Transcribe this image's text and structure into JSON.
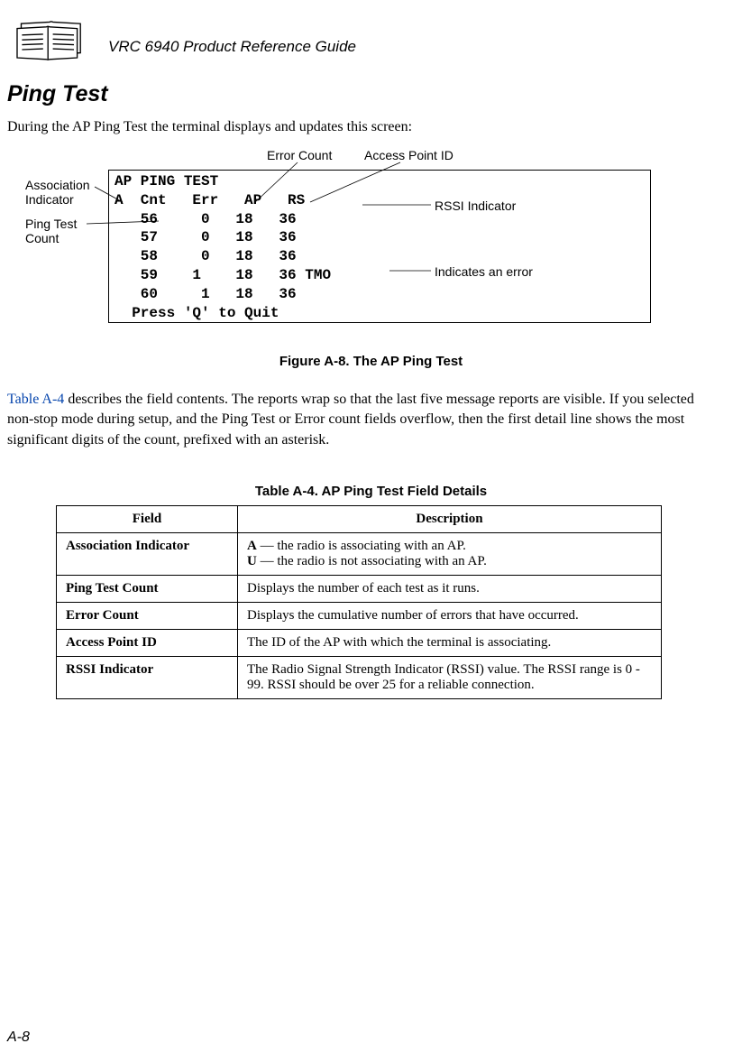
{
  "header": {
    "product": "VRC 6940 Product Reference Guide"
  },
  "section": {
    "title": "Ping Test"
  },
  "intro": "During the AP Ping Test the terminal displays and updates this screen:",
  "annotations": {
    "error_count": "Error Count",
    "access_point_id": "Access Point ID",
    "assoc1": "Association",
    "assoc2": "Indicator",
    "ping1": "Ping Test",
    "ping2": "Count",
    "rssi": "RSSI Indicator",
    "tmo": "Indicates an error"
  },
  "terminal": {
    "title": "AP PING TEST",
    "header_row": "A  Cnt   Err   AP   RS",
    "rows": [
      "   56     0   18   36",
      "   57     0   18   36",
      "   58     0   18   36",
      "   59    1    18   36 TMO",
      "   60     1   18   36"
    ],
    "footer": "  Press 'Q' to Quit"
  },
  "figure_caption": "Figure A-8.  The AP Ping Test",
  "body_link": "Table A-4",
  "body_rest": " describes the field contents. The reports wrap so that the last five message reports are visible. If you selected non-stop mode during setup, and the Ping Test or Error count fields overflow, then the first detail line shows the most significant digits of the count, prefixed with an asterisk.",
  "table_caption": "Table A-4. AP Ping Test Field Details",
  "table": {
    "headers": {
      "field": "Field",
      "desc": "Description"
    },
    "rows": [
      {
        "field": "Association Indicator",
        "desc_line1": "A — the radio is associating with an AP.",
        "desc_line2": "U — the radio is not associating with an AP."
      },
      {
        "field": "Ping Test Count",
        "desc_line1": "Displays the number of each test as it runs.",
        "desc_line2": ""
      },
      {
        "field": "Error Count",
        "desc_line1": "Displays the cumulative number of errors that have occurred.",
        "desc_line2": ""
      },
      {
        "field": "Access Point ID",
        "desc_line1": "The ID of the AP with which the terminal is associating.",
        "desc_line2": ""
      },
      {
        "field": "RSSI Indicator",
        "desc_line1": "The Radio Signal Strength Indicator (RSSI) value. The RSSI range is 0 - 99. RSSI should be over 25 for a reliable connection.",
        "desc_line2": ""
      }
    ]
  },
  "page_number": "A-8"
}
